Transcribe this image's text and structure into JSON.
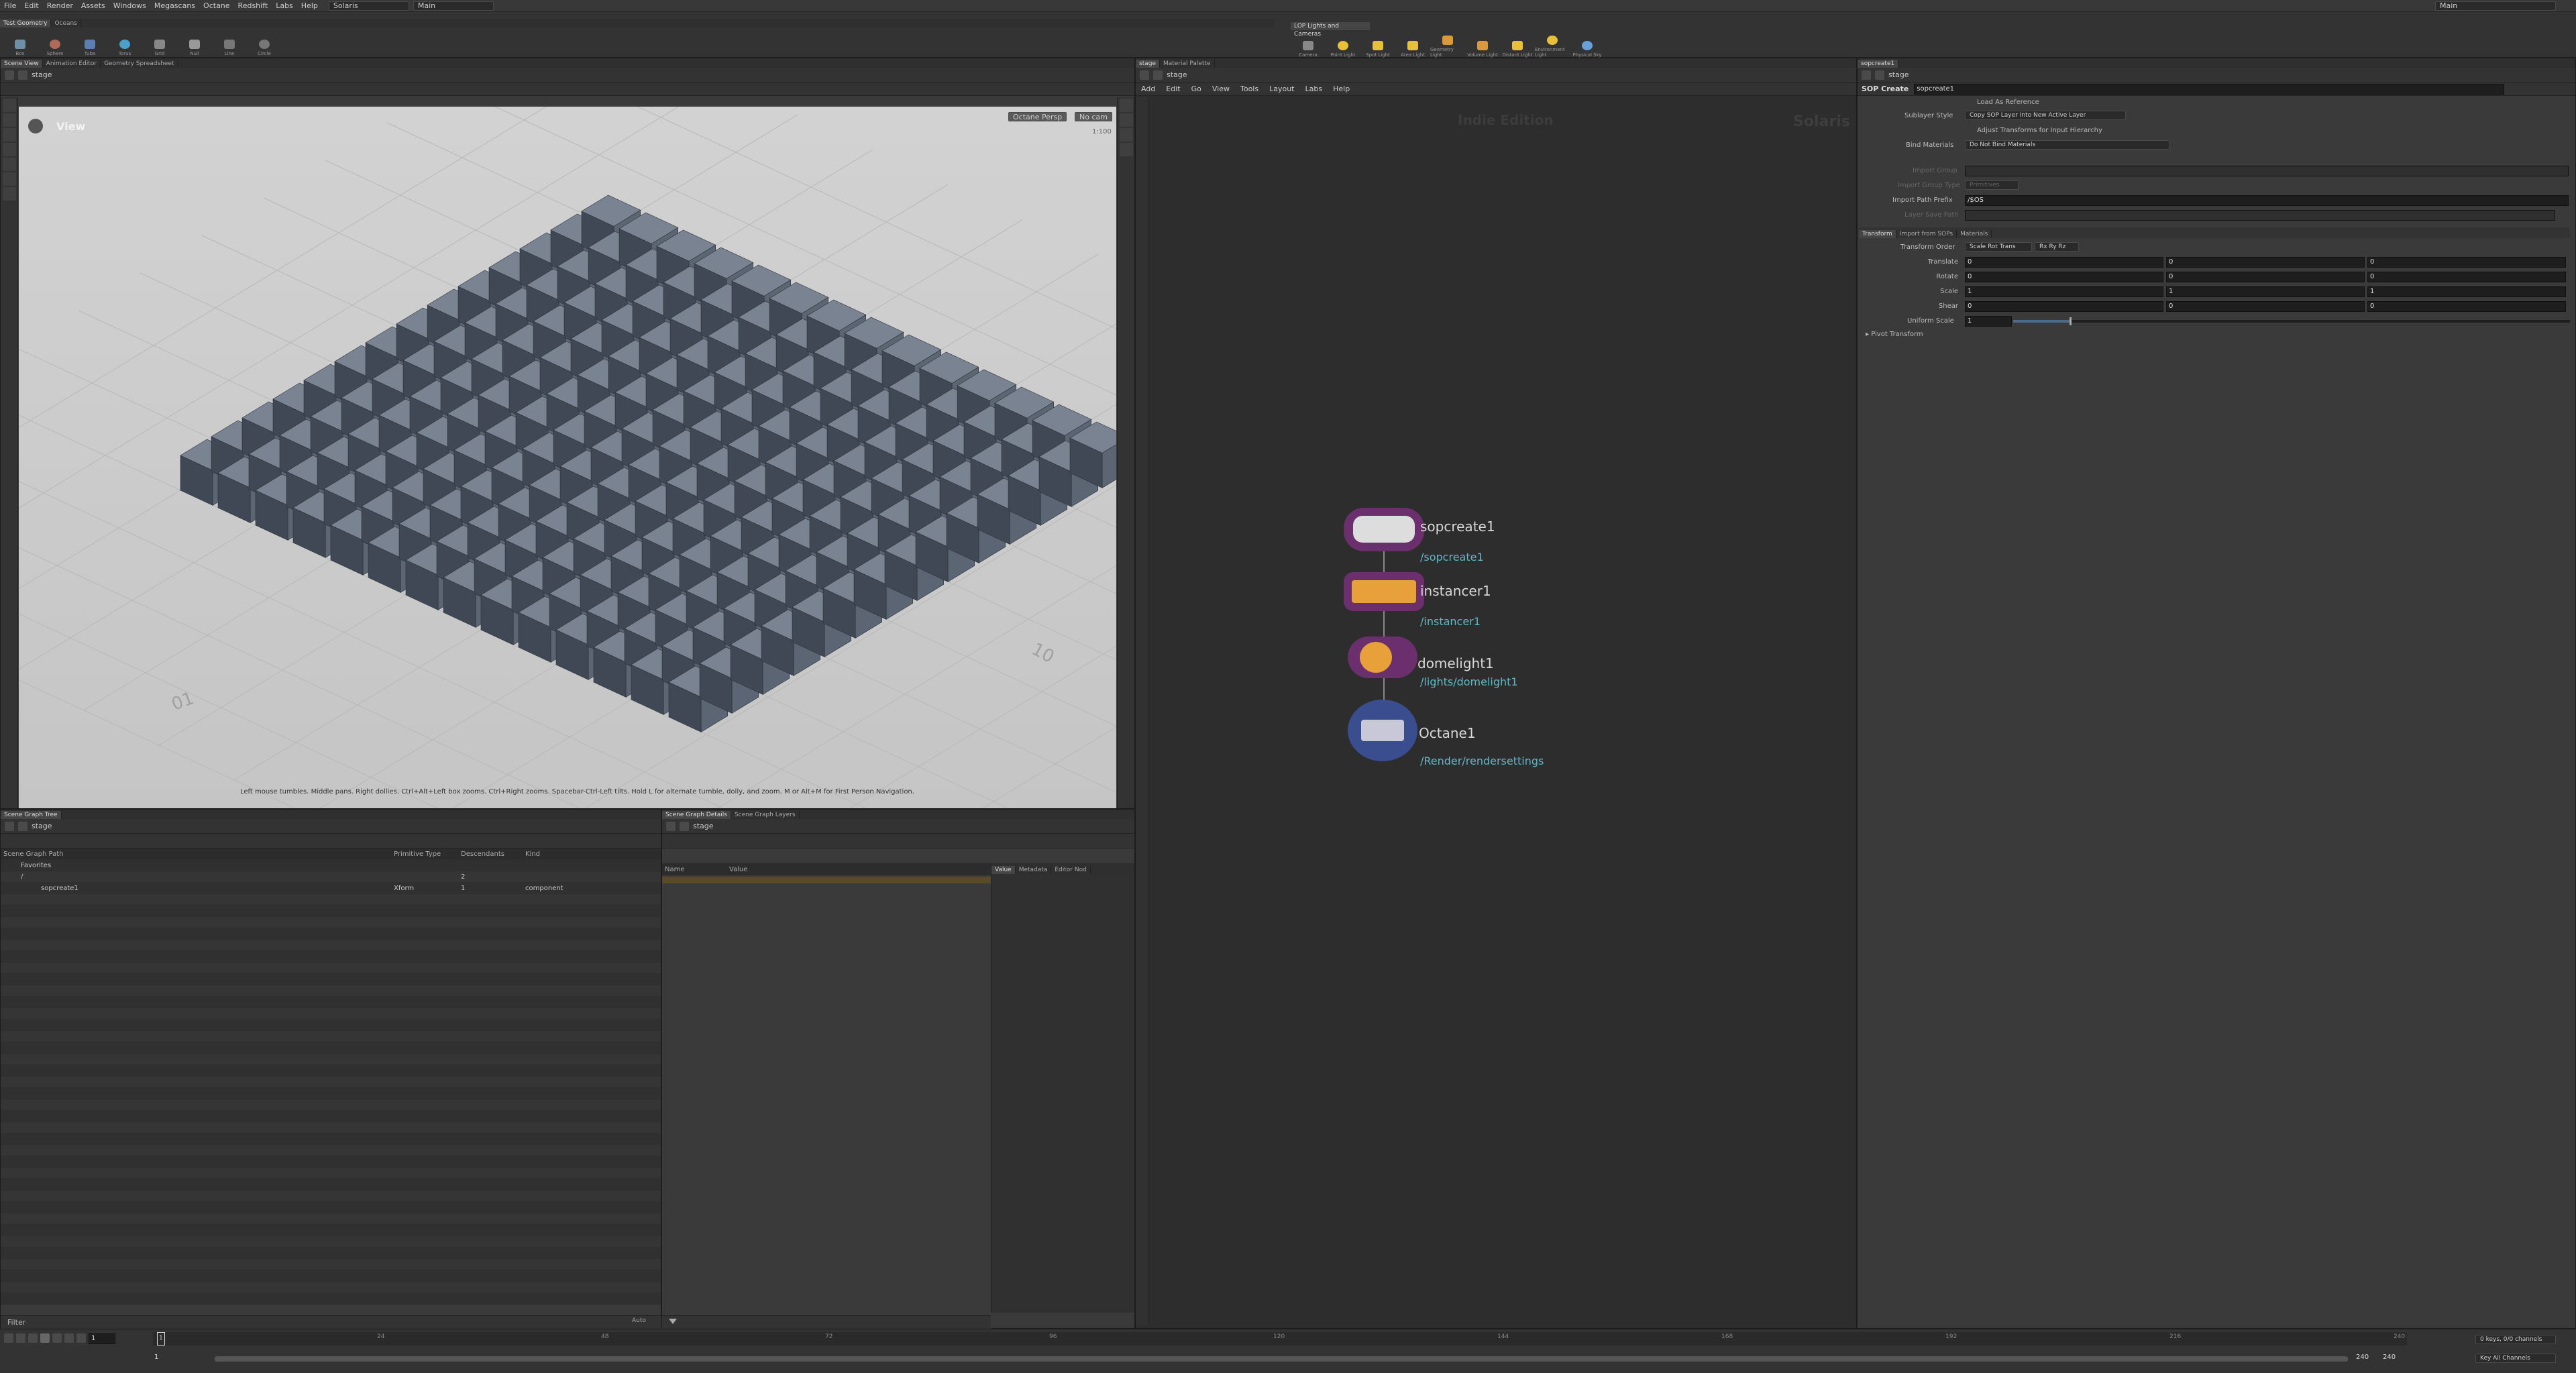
{
  "menubar": {
    "items": [
      "File",
      "Edit",
      "Render",
      "Assets",
      "Windows",
      "Megascans",
      "Octane",
      "Redshift",
      "Labs",
      "Help"
    ],
    "desktop": "Solaris",
    "context": "Main",
    "right_dd": "Main"
  },
  "shelf": {
    "left_tabs": [
      "Test Geometry",
      "Oceans"
    ],
    "left_tools": [
      "Box",
      "Sphere",
      "Tube",
      "Torus",
      "Grid",
      "Null",
      "Line",
      "Circle"
    ],
    "right_tabs": [
      "LOP Lights and Cameras"
    ],
    "right_tools": [
      "Camera",
      "Point Light",
      "Spot Light",
      "Area Light",
      "Geometry Light",
      "Volume Light",
      "Distant Light",
      "Environment Light",
      "Physical Sky"
    ]
  },
  "viewer": {
    "tabs": [
      "Scene View",
      "Animation Editor",
      "Geometry Spreadsheet"
    ],
    "path": "stage",
    "view_label": "View",
    "camera_menu": "Octane Persp",
    "lock_menu": "No cam",
    "fps_hint": "1:100",
    "status_text": "Left mouse tumbles. Middle pans. Right dollies. Ctrl+Alt+Left box zooms. Ctrl+Right zooms. Spacebar-Ctrl-Left tilts. Hold L for alternate tumble, dolly, and zoom. M or Alt+M for First Person Navigation.",
    "floor_labels": [
      "10",
      "01"
    ],
    "grid_cols": 14,
    "grid_rows": 14
  },
  "scene_graph": {
    "tabs": [
      "Scene Graph Tree"
    ],
    "path": "stage",
    "columns": [
      "Scene Graph Path",
      "Primitive Type",
      "Descendants",
      "Kind"
    ],
    "rows": [
      {
        "path": "Favorites",
        "type": "",
        "desc": "",
        "kind": ""
      },
      {
        "path": "/",
        "type": "",
        "desc": "2",
        "kind": ""
      },
      {
        "path": "sopcreate1",
        "type": "Xform",
        "desc": "1",
        "kind": "component"
      }
    ],
    "filter_label": "Filter"
  },
  "details": {
    "tabs": [
      "Scene Graph Details",
      "Scene Graph Layers"
    ],
    "path": "stage",
    "columns": [
      "Name",
      "Value"
    ],
    "side_tabs": [
      "Value",
      "Metadata",
      "Editor Nod"
    ]
  },
  "network": {
    "tabs": [
      "stage",
      "Material Palette"
    ],
    "path": "stage",
    "menu": [
      "Add",
      "Edit",
      "Go",
      "View",
      "Tools",
      "Layout",
      "Labs",
      "Help"
    ],
    "watermark_edition": "Indie Edition",
    "watermark_context": "Solaris",
    "nodes": [
      {
        "name": "sopcreate1",
        "path": "/sopcreate1"
      },
      {
        "name": "instancer1",
        "path": "/instancer1"
      },
      {
        "name": "domelight1",
        "path": "/lights/domelight1"
      },
      {
        "name": "Octane1",
        "path": "/Render/rendersettings"
      }
    ]
  },
  "params": {
    "tabs": [
      "sopcreate1"
    ],
    "path": "stage",
    "node_type": "SOP Create",
    "node_name": "sopcreate1",
    "load_as_reference": "Load As Reference",
    "sublayer_style_label": "Sublayer Style",
    "sublayer_style_value": "Copy SOP Layer Into New Active Layer",
    "adjust_transforms": "Adjust Transforms for Input Hierarchy",
    "bind_materials_label": "Bind Materials",
    "bind_materials_value": "Do Not Bind Materials",
    "import_group": "Import Group",
    "import_group_type": "Import Group Type",
    "import_group_type_value": "Primitives",
    "import_path_prefix": "Import Path Prefix",
    "import_path_prefix_value": "/$OS",
    "layer_save_path": "Layer Save Path",
    "sub_tabs": [
      "Transform",
      "Import from SOPs",
      "Materials"
    ],
    "transform_order_label": "Transform Order",
    "transform_order_value": "Scale Rot Trans",
    "rot_order_value": "Rx Ry Rz",
    "rows": [
      {
        "label": "Translate",
        "values": [
          "0",
          "0",
          "0"
        ]
      },
      {
        "label": "Rotate",
        "values": [
          "0",
          "0",
          "0"
        ]
      },
      {
        "label": "Scale",
        "values": [
          "1",
          "1",
          "1"
        ]
      },
      {
        "label": "Shear",
        "values": [
          "0",
          "0",
          "0"
        ]
      }
    ],
    "uniform_scale_label": "Uniform Scale",
    "uniform_scale_value": "1",
    "pivot_transform": "Pivot Transform"
  },
  "timeline": {
    "frame": "1",
    "start": "1",
    "range_start": "1",
    "end": "240",
    "end2": "240",
    "ticks": [
      "24",
      "48",
      "72",
      "96",
      "120",
      "144",
      "168",
      "192",
      "216",
      "240"
    ],
    "keys_label": "0 keys, 0/0 channels",
    "key_all_label": "Key All Channels",
    "auto_label": "Auto"
  },
  "colors": {
    "accent_orange": "#e8a13a",
    "node_purple": "#6b2f6e",
    "node_blue": "#3a4d8f",
    "link_cyan": "#5fb8c8"
  }
}
